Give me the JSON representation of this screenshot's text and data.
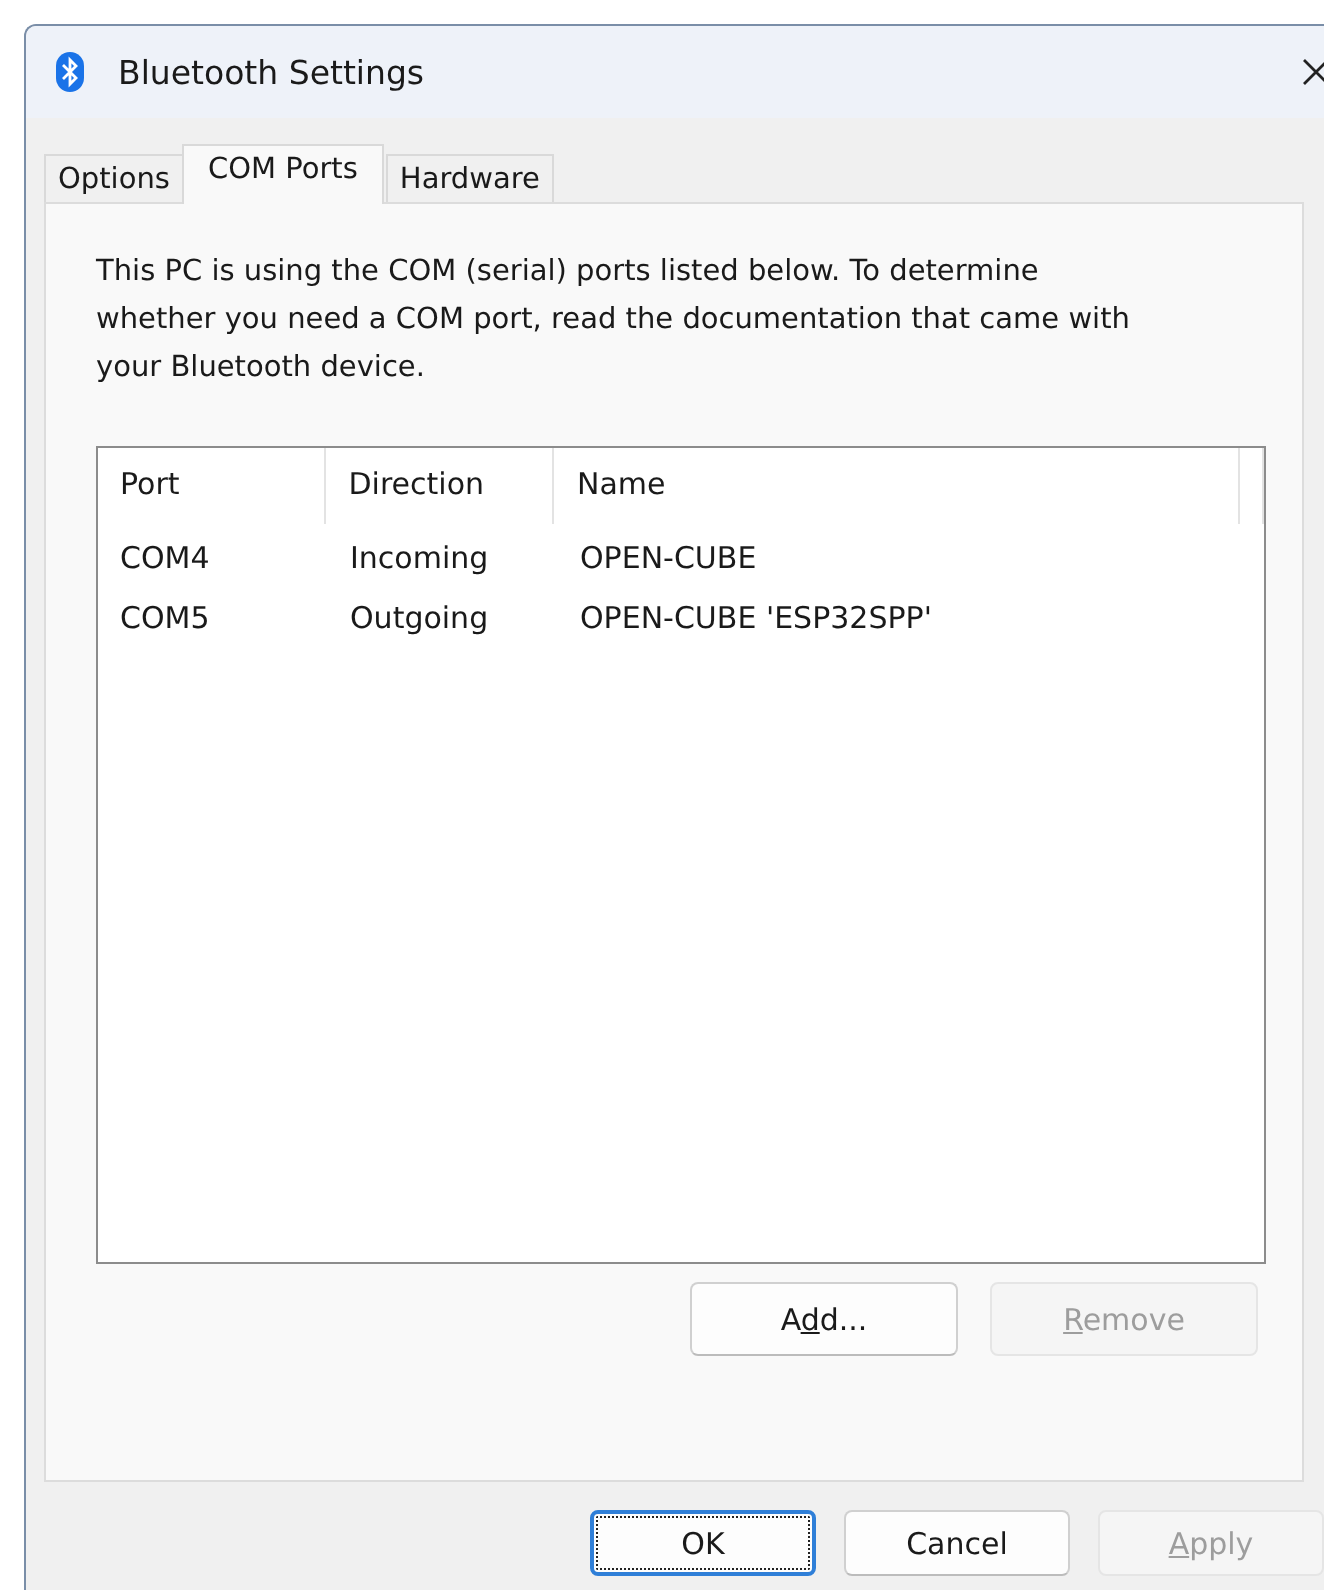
{
  "window": {
    "title": "Bluetooth Settings"
  },
  "tabs": [
    {
      "label": "Options",
      "selected": false
    },
    {
      "label": "COM Ports",
      "selected": true
    },
    {
      "label": "Hardware",
      "selected": false
    }
  ],
  "description": "This PC is using the COM (serial) ports listed below. To determine whether you need a COM port, read the documentation that came with your Bluetooth device.",
  "table": {
    "columns": [
      "Port",
      "Direction",
      "Name"
    ],
    "rows": [
      [
        "COM4",
        "Incoming",
        "OPEN-CUBE"
      ],
      [
        "COM5",
        "Outgoing",
        "OPEN-CUBE 'ESP32SPP'"
      ]
    ]
  },
  "list_buttons": [
    {
      "before": "A",
      "key": "d",
      "after": "d...",
      "disabled": false
    },
    {
      "key": "R",
      "after": "emove",
      "disabled": true
    }
  ],
  "dialog_buttons": [
    {
      "before": "OK",
      "disabled": false,
      "default": true
    },
    {
      "before": "Cancel",
      "disabled": false,
      "default": false
    },
    {
      "key": "A",
      "after": "pply",
      "disabled": true,
      "default": false
    }
  ]
}
